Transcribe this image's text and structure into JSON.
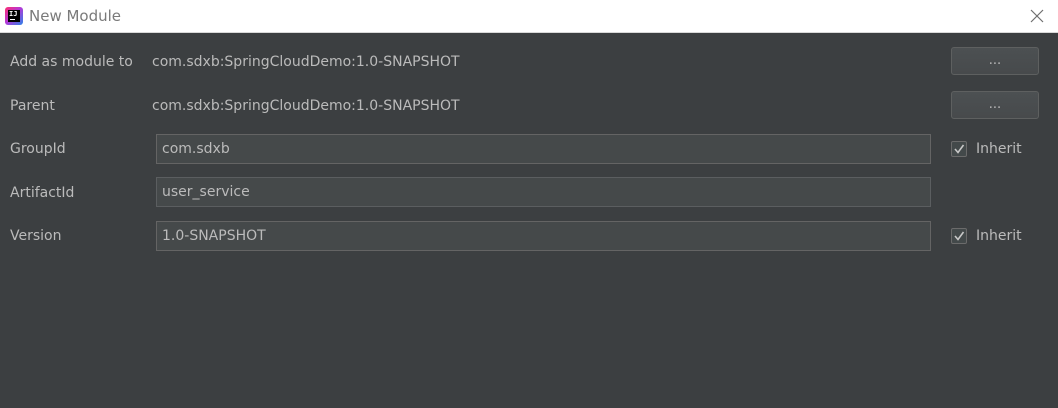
{
  "window": {
    "title": "New Module",
    "app_icon": "intellij-idea-icon",
    "close_icon": "close-icon"
  },
  "form": {
    "add_as_module_to": {
      "label": "Add as module to",
      "value": "com.sdxb:SpringCloudDemo:1.0-SNAPSHOT",
      "button_label": "..."
    },
    "parent": {
      "label": "Parent",
      "value": "com.sdxb:SpringCloudDemo:1.0-SNAPSHOT",
      "button_label": "..."
    },
    "group_id": {
      "label": "GroupId",
      "value": "com.sdxb",
      "inherit_label": "Inherit",
      "inherit_checked": true
    },
    "artifact_id": {
      "label": "ArtifactId",
      "value": "user_service"
    },
    "version": {
      "label": "Version",
      "value": "1.0-SNAPSHOT",
      "inherit_label": "Inherit",
      "inherit_checked": true
    }
  },
  "colors": {
    "background": "#3c3f41",
    "text": "#bbbbbb",
    "titlebar": "#ffffff"
  }
}
